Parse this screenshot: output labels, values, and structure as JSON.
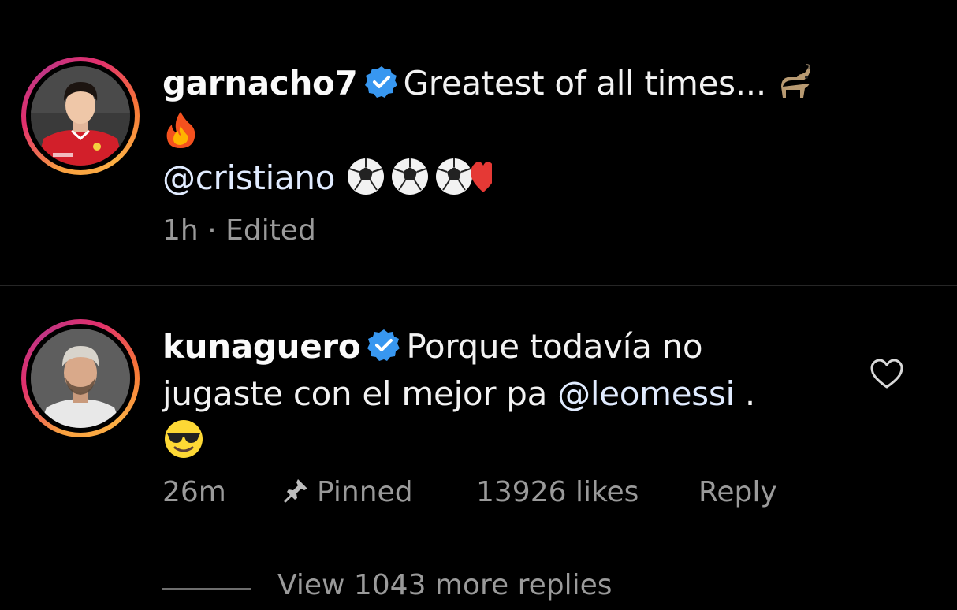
{
  "comments": [
    {
      "username": "garnacho7",
      "verified": true,
      "text_line1": "Greatest of all times...",
      "mention": "@cristiano",
      "time": "1h",
      "separator": "·",
      "edited_label": "Edited",
      "emojis": [
        "goat-emoji",
        "fire-emoji",
        "soccer-ball-emoji",
        "soccer-ball-emoji",
        "soccer-ball-emoji",
        "red-heart-emoji"
      ]
    },
    {
      "username": "kunaguero",
      "verified": true,
      "text_part1": "Porque todavía no",
      "text_part2": "jugaste con el mejor pa",
      "mention": "@leomessi",
      "text_end": ".",
      "time": "26m",
      "pinned_label": "Pinned",
      "likes_label": "13926 likes",
      "reply_label": "Reply",
      "view_replies_label": "View 1043 more replies",
      "emojis": [
        "sunglasses-emoji"
      ]
    }
  ],
  "colors": {
    "background": "#000000",
    "text": "#f5f5f5",
    "meta": "#9a9a9a",
    "verified": "#3897f0",
    "divider": "#262626"
  }
}
